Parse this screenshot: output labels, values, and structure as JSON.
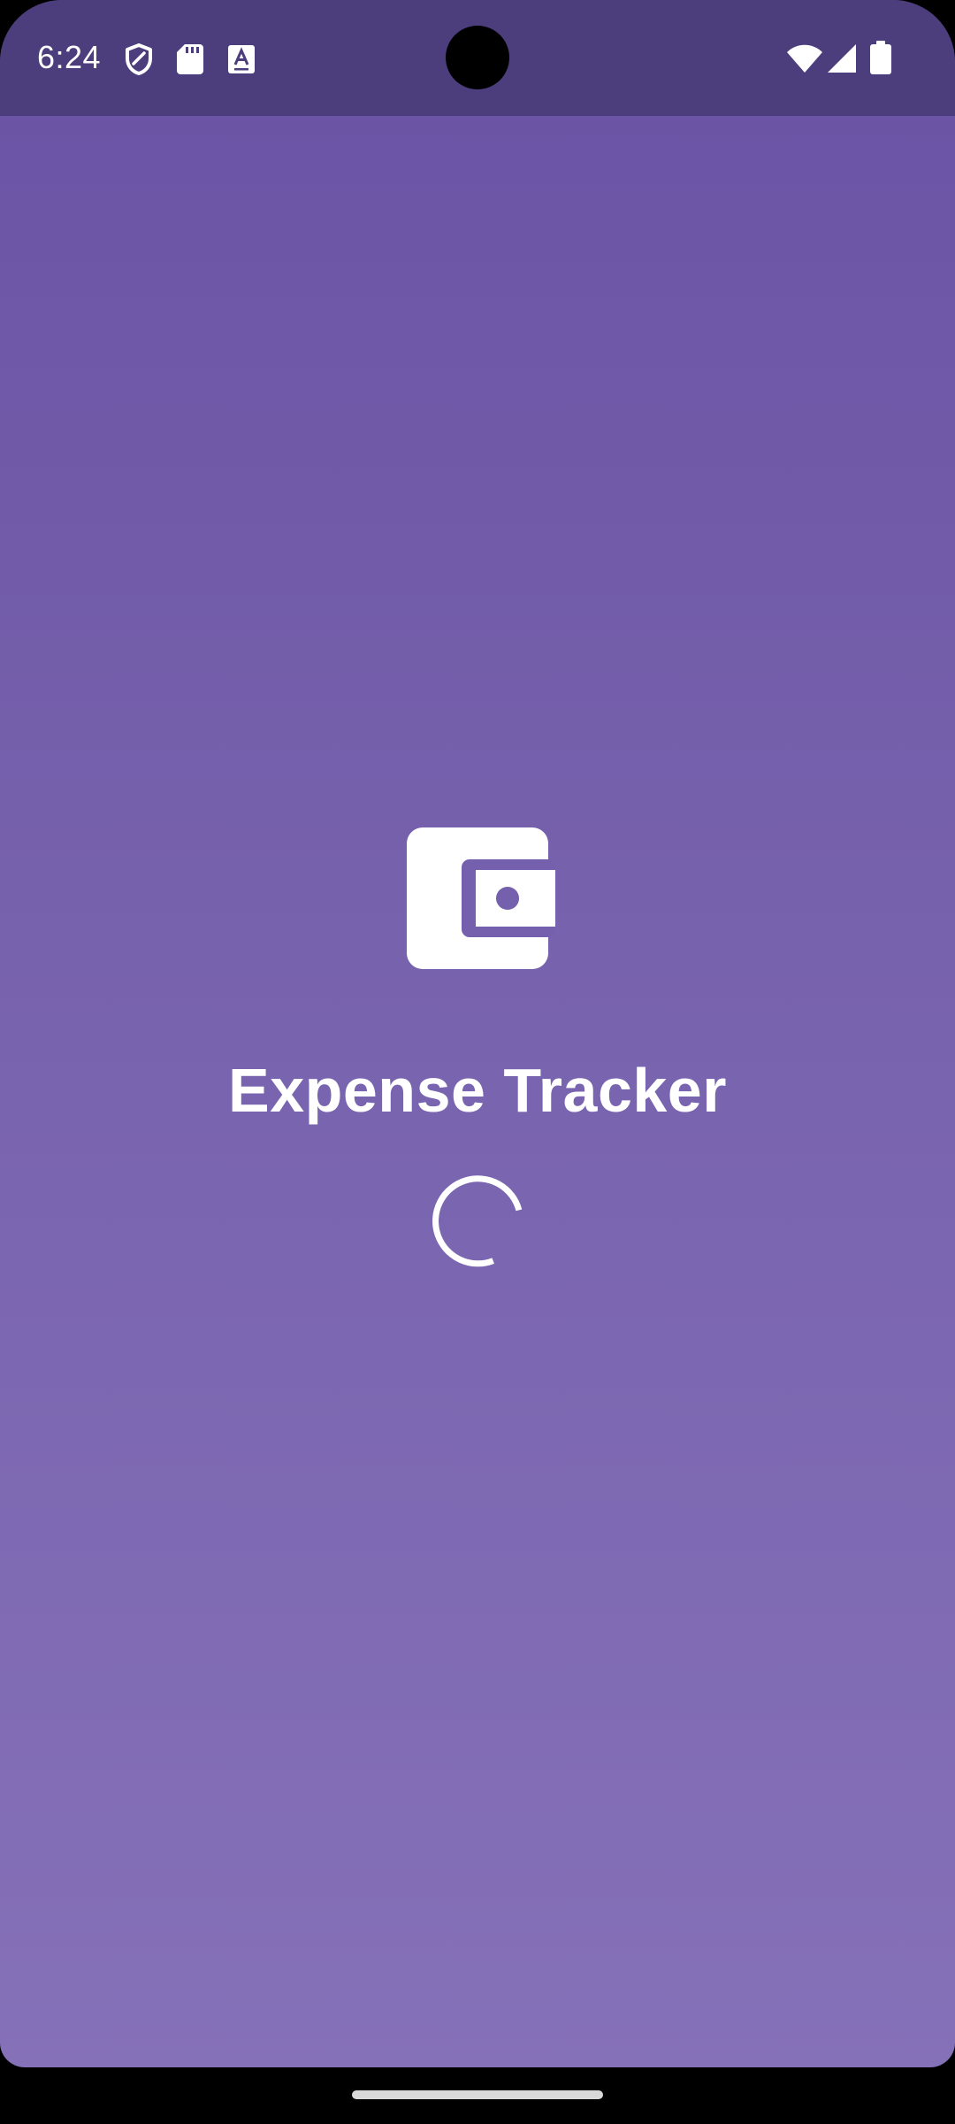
{
  "status_bar": {
    "time": "6:24",
    "left_icons": [
      "shield-icon",
      "sd-card-icon",
      "keyboard-a-icon"
    ],
    "right_icons": [
      "wifi-icon",
      "cell-signal-icon",
      "battery-icon"
    ]
  },
  "splash": {
    "app_name": "Expense Tracker",
    "logo_icon": "wallet-icon",
    "loading_indicator": "progress-spinner-icon"
  },
  "colors": {
    "status_bar_bg": "#4c3d7c",
    "background_top": "#6a52a4",
    "background_bottom": "#8571b8",
    "foreground": "#ffffff"
  },
  "navigation": {
    "home_indicator": "gesture-bar"
  }
}
